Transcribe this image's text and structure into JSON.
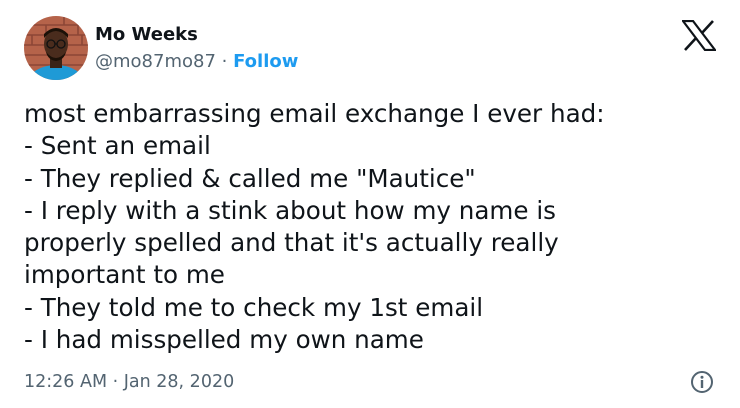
{
  "author": {
    "display_name": "Mo Weeks",
    "handle": "@mo87mo87",
    "separator": "·",
    "follow_label": "Follow"
  },
  "tweet": {
    "lines": [
      "most embarrassing email exchange I ever had:",
      "- Sent an email",
      "- They replied & called me \"Mautice\"",
      "- I reply with a stink about how my name is",
      "properly spelled and that it's actually really",
      "important to me",
      "- They told me to check my 1st email",
      "- I had misspelled my own name"
    ],
    "timestamp": "12:26 AM · Jan 28, 2020"
  },
  "icons": {
    "platform_logo": "x-logo-icon",
    "info": "info-icon"
  },
  "colors": {
    "link_blue": "#1d9bf0",
    "muted_gray": "#536471",
    "text": "#0f1419"
  }
}
